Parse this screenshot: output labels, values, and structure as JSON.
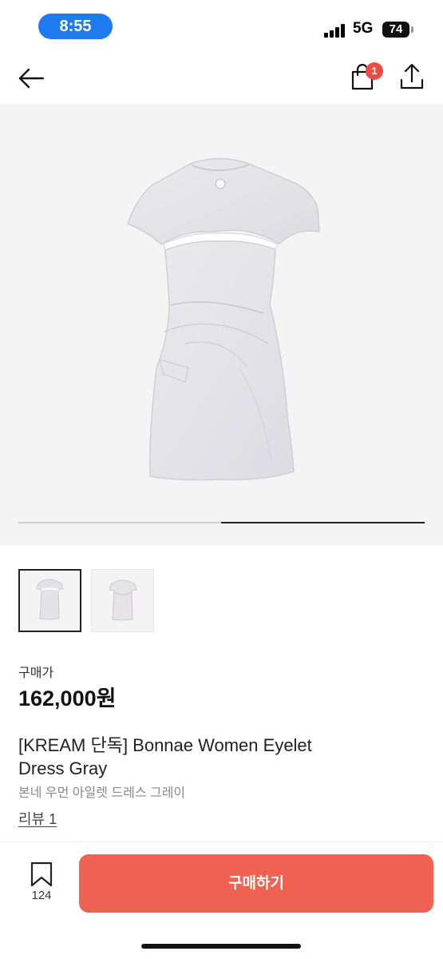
{
  "status_bar": {
    "time": "8:55",
    "network": "5G",
    "battery": "74"
  },
  "header": {
    "back_icon": "arrow-left-icon",
    "bag_icon": "shopping-bag-icon",
    "bag_badge": "1",
    "share_icon": "share-icon"
  },
  "gallery": {
    "image_count": 2,
    "current_index": 2,
    "thumbnails": [
      {
        "selected": true
      },
      {
        "selected": false
      }
    ]
  },
  "product": {
    "price_label": "구매가",
    "price": "162,000원",
    "title": "[KREAM 단독] Bonnae Women Eyelet Dress Gray",
    "subtitle": "본네 우먼 아일렛 드레스 그레이",
    "review_link": "리뷰 1"
  },
  "bottom_bar": {
    "wish_icon": "bookmark-icon",
    "wish_count": "124",
    "buy_label": "구매하기"
  },
  "colors": {
    "accent": "#ef6252",
    "time_pill": "#1f7af2",
    "badge": "#ef4b42"
  }
}
